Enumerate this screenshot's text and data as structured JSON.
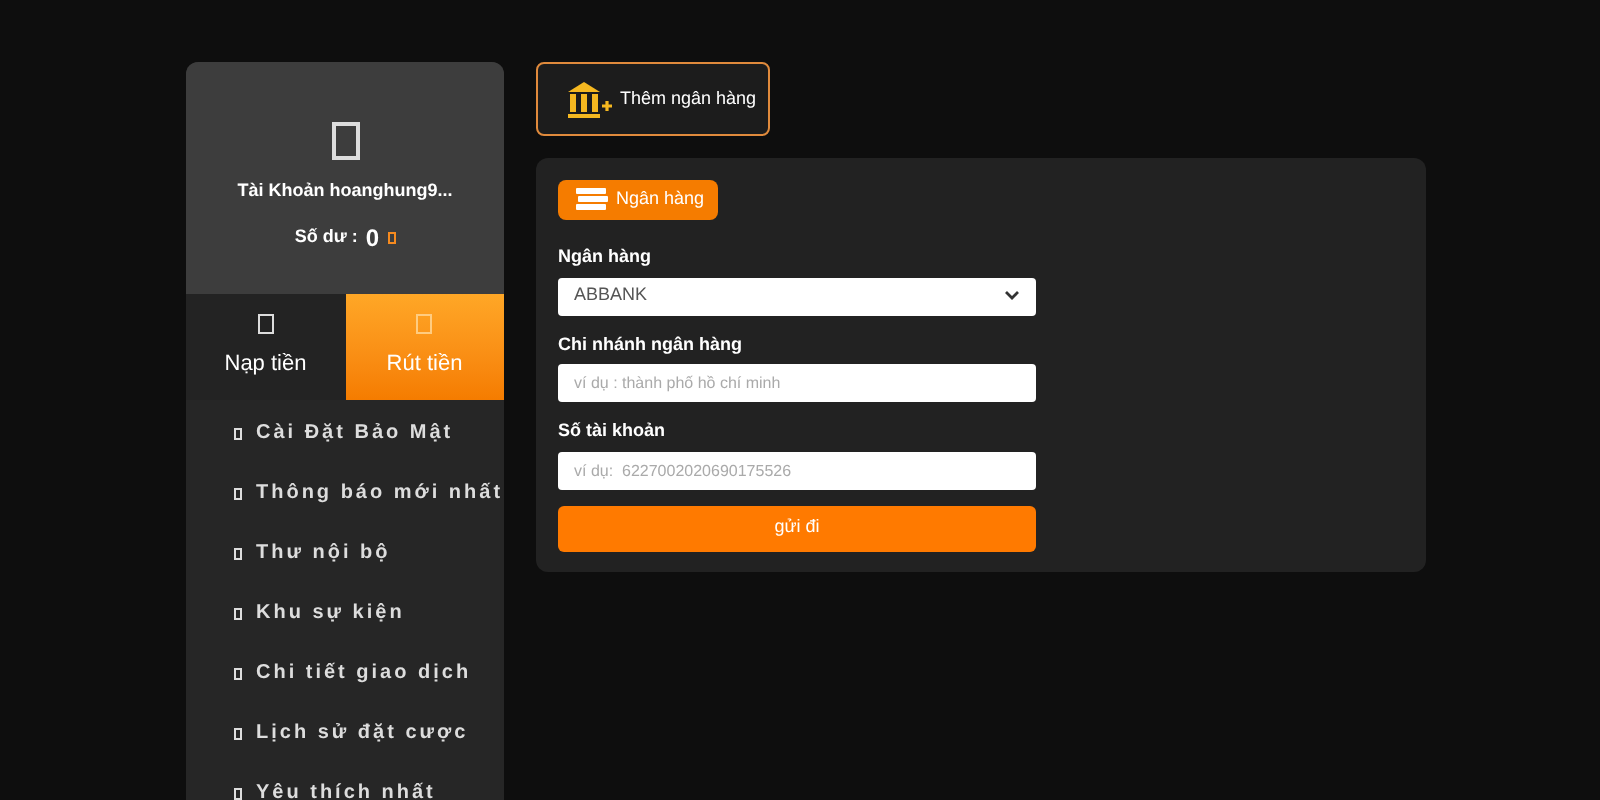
{
  "profile": {
    "account": "Tài Khoản hoanghung9...",
    "balance_label": "Số dư :",
    "balance": "0"
  },
  "tabs": [
    {
      "label": "Nạp tiền",
      "selected": false
    },
    {
      "label": "Rút tiền",
      "selected": true
    }
  ],
  "menu": [
    "Cài Đặt Bảo Mật",
    "Thông báo mới nhất",
    "Thư nội bộ",
    "Khu sự kiện",
    "Chi tiết giao dịch",
    "Lịch sử đặt cược",
    "Yêu thích nhất"
  ],
  "add_bank_button": "Thêm ngân hàng",
  "form": {
    "section_tag": "Ngân hàng",
    "fields": [
      {
        "kind": "select",
        "label": "Ngân hàng",
        "value": "ABBANK"
      },
      {
        "kind": "input",
        "label": "Chi nhánh ngân hàng",
        "placeholder": "ví dụ : thành phố hồ chí minh"
      },
      {
        "kind": "input",
        "label": "Số tài khoản",
        "placeholder": "ví dụ:  6227002020690175526"
      }
    ],
    "submit": "gửi đi"
  }
}
